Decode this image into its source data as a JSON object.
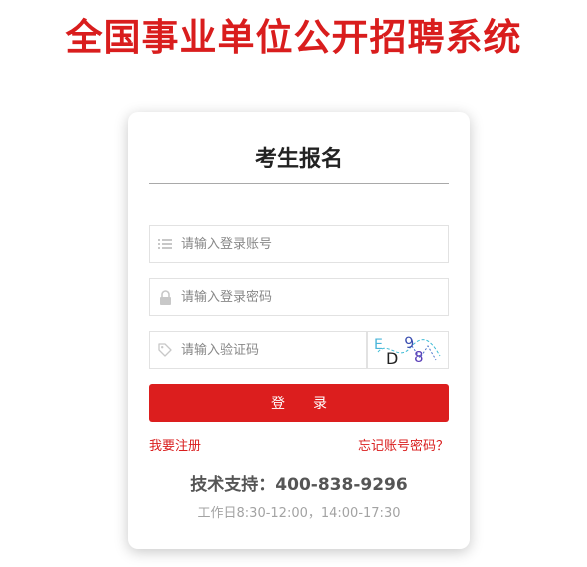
{
  "header": {
    "title": "全国事业单位公开招聘系统"
  },
  "login_card": {
    "title": "考生报名",
    "username_placeholder": "请输入登录账号",
    "password_placeholder": "请输入登录密码",
    "captcha_placeholder": "请输入验证码",
    "captcha_text": "ED98",
    "login_label": "登录",
    "register_link": "我要注册",
    "forgot_link": "忘记账号密码？",
    "support": "技术支持：400-838-9296",
    "hours": "工作日8:30-12:00，14:00-17:30"
  },
  "icons": {
    "username": "list-icon",
    "password": "lock-icon",
    "captcha": "tag-icon"
  },
  "colors": {
    "brand_red": "#d91d1d",
    "button_red": "#dc1e1e"
  }
}
